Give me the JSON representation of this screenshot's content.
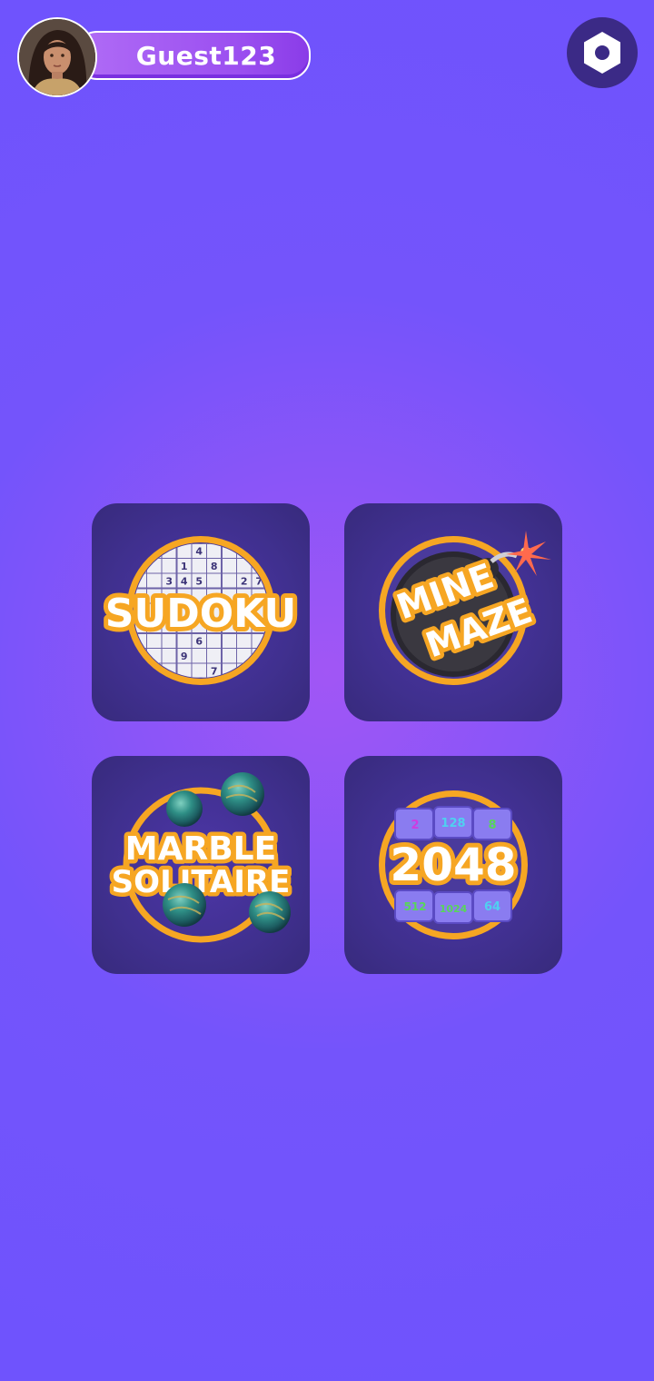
{
  "profile": {
    "username": "Guest123"
  },
  "colors": {
    "background": "#6f53fd",
    "tile": "#40308f",
    "accent_orange": "#f6a623",
    "settings_bg": "#3b2a86"
  },
  "icons": {
    "settings": "hexagon-nut-icon"
  },
  "games": [
    {
      "id": "sudoku",
      "title": "SUDOKU",
      "digits": [
        "4",
        "1",
        "8",
        "3",
        "4",
        "5",
        "2",
        "7",
        "6",
        "9",
        "7"
      ]
    },
    {
      "id": "mine_maze",
      "title_line1": "MINE",
      "title_line2": "MAZE"
    },
    {
      "id": "marble_solitaire",
      "title_line1": "MARBLE",
      "title_line2": "SOLITAIRE"
    },
    {
      "id": "2048",
      "title": "2048",
      "tiles": [
        "2",
        "128",
        "8",
        "512",
        "1024",
        "64"
      ]
    }
  ]
}
